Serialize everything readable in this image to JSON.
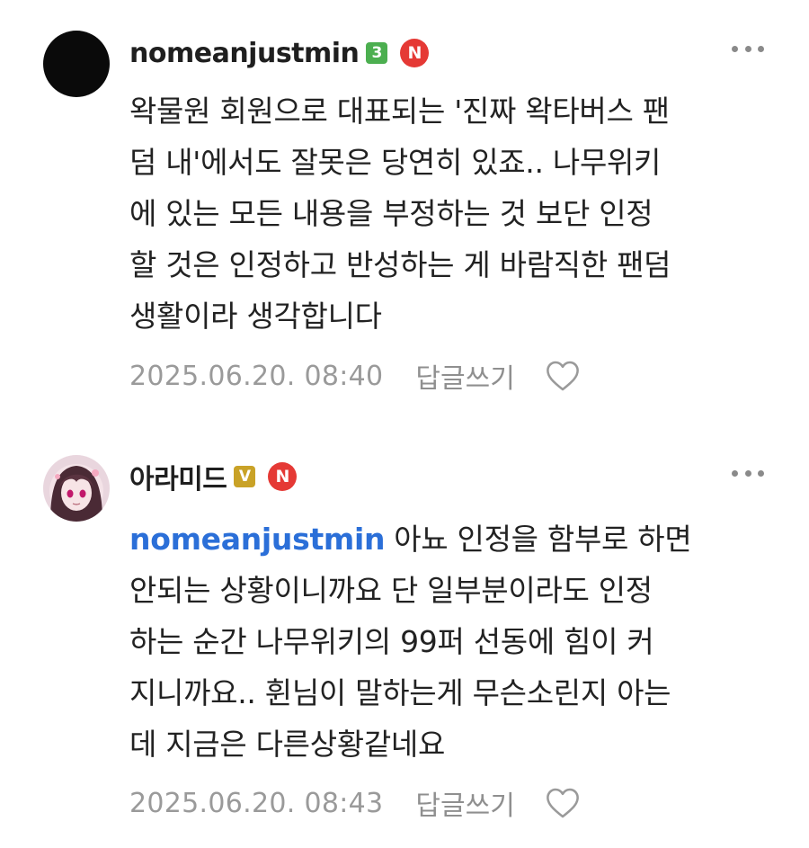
{
  "comments": [
    {
      "nickname": "nomeanjustmin",
      "level_badge": "3",
      "n_badge": "N",
      "lines": [
        "왁물원 회원으로 대표되는 '진짜 왁타버스 팬",
        "덤 내'에서도 잘못은 당연히 있죠.. 나무위키",
        "에 있는 모든 내용을 부정하는 것 보단 인정",
        "할 것은 인정하고 반성하는 게 바람직한 팬덤",
        "생활이라 생각합니다"
      ],
      "timestamp": "2025.06.20. 08:40",
      "reply_label": "답글쓰기",
      "avatar": "black-circle-avatar",
      "more_icon": "more-dots-icon",
      "like_icon": "heart-outline-icon"
    },
    {
      "nickname": "아라미드",
      "level_badge": "V",
      "n_badge": "N",
      "mention": "nomeanjustmin",
      "first_line_text": "아뇨 인정을 함부로 하면",
      "lines": [
        "안되는 상황이니까요 단 일부분이라도 인정",
        "하는 순간 나무위키의 99퍼 선동에 힘이 커",
        "지니까요.. 휜님이 말하는게 무슨소린지 아는",
        "데 지금은 다른상황같네요"
      ],
      "timestamp": "2025.06.20. 08:43",
      "reply_label": "답글쓰기",
      "avatar": "anime-girl-avatar",
      "more_icon": "more-dots-icon",
      "like_icon": "heart-outline-icon"
    }
  ],
  "colors": {
    "level3_badge": "#4caf50",
    "levelV_badge": "#c9a227",
    "n_badge": "#e53935",
    "mention": "#2b6fd8",
    "meta_text": "#9a9a9a"
  }
}
